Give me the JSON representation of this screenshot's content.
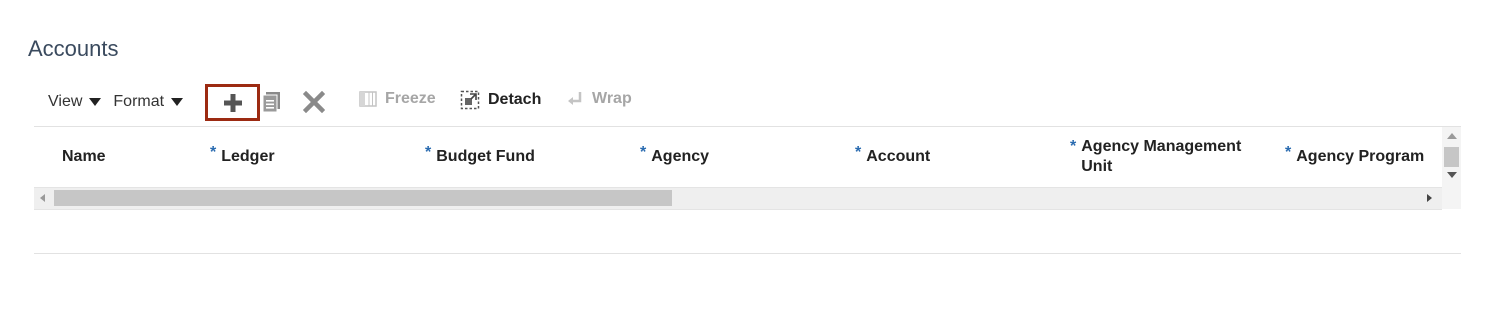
{
  "page": {
    "title": "Accounts"
  },
  "toolbar": {
    "view_label": "View",
    "format_label": "Format",
    "add_icon": "plus-icon",
    "duplicate_icon": "duplicate-icon",
    "delete_icon": "delete-x-icon",
    "freeze_label": "Freeze",
    "detach_label": "Detach",
    "wrap_label": "Wrap",
    "highlight_color": "#9c2a12"
  },
  "table": {
    "columns": [
      {
        "label": "Name",
        "required": ""
      },
      {
        "label": "Ledger",
        "required": "*"
      },
      {
        "label": "Budget Fund",
        "required": "*"
      },
      {
        "label": "Agency",
        "required": "*"
      },
      {
        "label": "Account",
        "required": "*"
      },
      {
        "label": "Agency Management Unit",
        "required": "*"
      },
      {
        "label": "Agency Program",
        "required": "*"
      }
    ]
  },
  "colors": {
    "title": "#3a4a5e",
    "required_marker": "#2a6bb0",
    "disabled_text": "#a6a6a6"
  }
}
